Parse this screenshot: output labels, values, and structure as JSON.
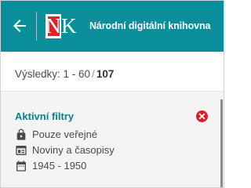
{
  "header": {
    "back_icon": "arrow-left-icon",
    "logo_letters": "NK",
    "title": "Národní digitální knihovna"
  },
  "results": {
    "label": "Výsledky: 1 - 60",
    "separator": "/",
    "total": "107"
  },
  "filters": {
    "title": "Aktivní filtry",
    "remove_icon": "close-circle-icon",
    "items": [
      {
        "icon": "lock-icon",
        "label": "Pouze veřejné"
      },
      {
        "icon": "newspaper-icon",
        "label": "Noviny a časopisy"
      },
      {
        "icon": "calendar-icon",
        "label": "1945 - 1950"
      }
    ]
  },
  "colors": {
    "header_bg": "#0a8e99",
    "accent_text": "#0b7f89",
    "logo_red": "#d9262b",
    "remove_red": "#d3202a",
    "panel_bg": "#f4f4f4"
  }
}
